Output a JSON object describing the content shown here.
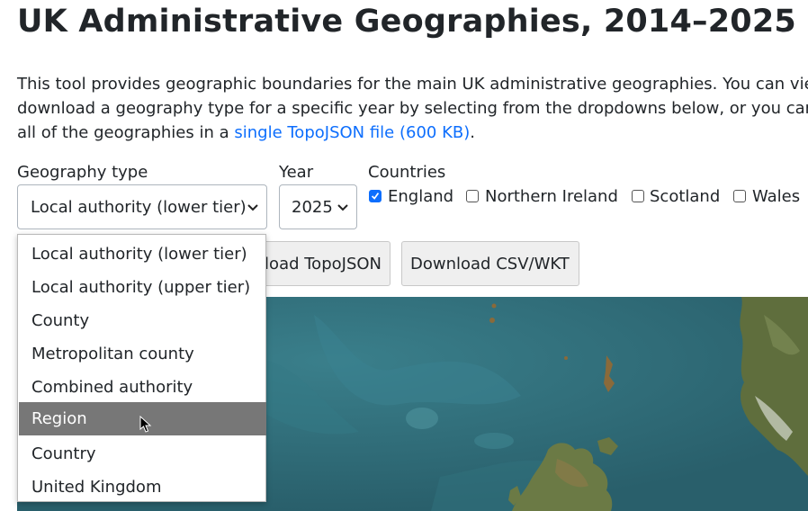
{
  "page": {
    "title": "UK Administrative Geographies, 2014–2025",
    "intro_line1": "This tool provides geographic boundaries for the main UK administrative geographies. You can view",
    "intro_line2": "download a geography type for a specific year by selecting from the dropdowns below, or you can d",
    "intro_line3_prefix": "all of the geographies in a ",
    "intro_link": "single TopoJSON file (600 KB)",
    "intro_line3_suffix": "."
  },
  "controls": {
    "geography_label": "Geography type",
    "geography_value": "Local authority (lower tier)",
    "year_label": "Year",
    "year_value": "2025",
    "countries_label": "Countries",
    "countries": [
      {
        "label": "England",
        "checked": true
      },
      {
        "label": "Northern Ireland",
        "checked": false
      },
      {
        "label": "Scotland",
        "checked": false
      },
      {
        "label": "Wales",
        "checked": false
      }
    ]
  },
  "buttons": {
    "topojson": "Download TopoJSON",
    "csv": "Download CSV/WKT"
  },
  "dropdown": {
    "options": [
      "Local authority (lower tier)",
      "Local authority (upper tier)",
      "County",
      "Metropolitan county",
      "Combined authority",
      "Region",
      "Country",
      "United Kingdom"
    ],
    "highlighted": "Region"
  },
  "colors": {
    "link": "#0d6efd",
    "checkbox": "#0d6efd",
    "highlight": "#777777",
    "sea": "#2e6a77",
    "land": "#6b7a45"
  }
}
